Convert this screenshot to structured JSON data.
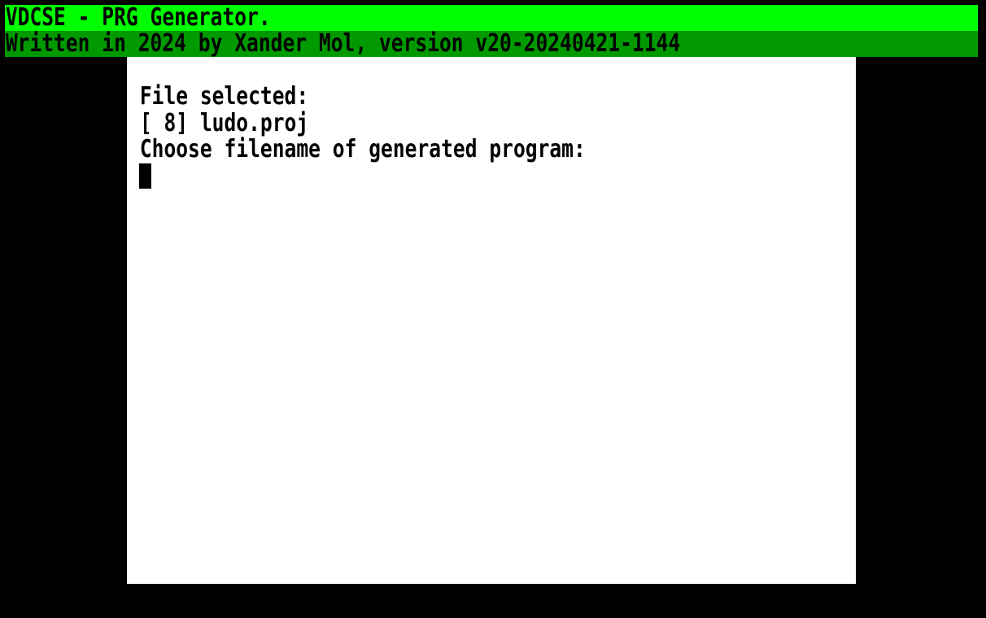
{
  "header": {
    "title": "VDCSE - PRG Generator.",
    "subtitle": "Written in 2024 by Xander Mol, version v20-20240421-1144"
  },
  "console": {
    "lines": [
      "File selected:",
      "[ 8] ludo.proj",
      "Choose filename of generated program:"
    ],
    "input_value": ""
  },
  "colors": {
    "title_bar": "#00ff00",
    "subtitle_bar": "#009a00",
    "panel": "#ffffff",
    "background": "#000000",
    "text": "#000000"
  }
}
